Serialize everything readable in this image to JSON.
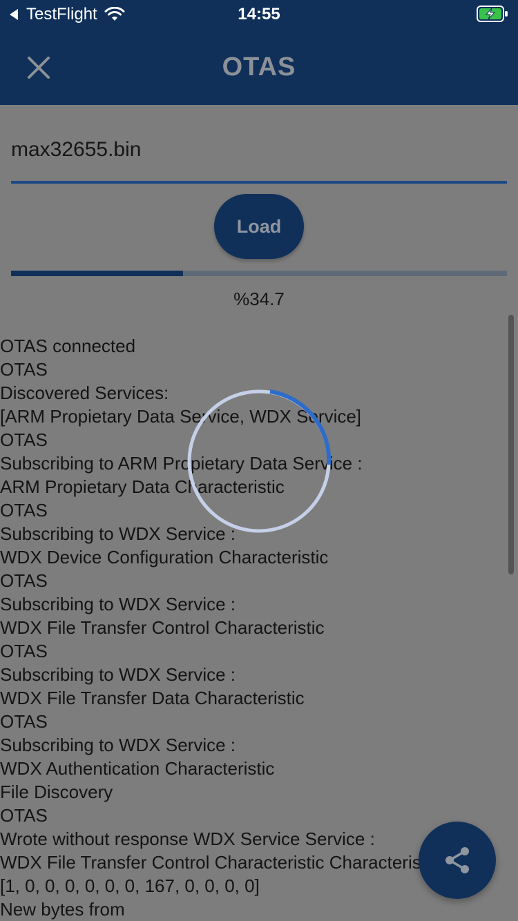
{
  "status_bar": {
    "carrier": "TestFlight",
    "time": "14:55",
    "icons": [
      "back-arrow-icon",
      "wifi-icon",
      "battery-charging-icon"
    ]
  },
  "app_bar": {
    "title": "OTAS",
    "close_icon": "close-icon"
  },
  "file_input": {
    "value": "max32655.bin"
  },
  "load_button": {
    "label": "Load"
  },
  "progress": {
    "percent_value": 34.7,
    "text": "%34.7"
  },
  "log": {
    "lines": [
      "OTAS connected",
      "OTAS",
      "Discovered Services:",
      "[ARM Propietary Data Service, WDX Service]",
      "OTAS",
      "Subscribing to ARM Propietary Data Service :",
      "ARM Propietary Data Characteristic",
      "OTAS",
      "Subscribing to WDX Service :",
      "WDX Device Configuration Characteristic",
      "OTAS",
      "Subscribing to WDX Service :",
      "WDX File Transfer Control Characteristic",
      "OTAS",
      "Subscribing to WDX Service :",
      "WDX File Transfer Data Characteristic",
      "OTAS",
      "Subscribing to WDX Service :",
      "WDX Authentication Characteristic",
      "File Discovery",
      "OTAS",
      "Wrote without response WDX Service Service :",
      "WDX File Transfer Control Characteristic Characteristic :",
      "[1, 0, 0, 0, 0, 0, 0, 167, 0, 0, 0, 0]",
      "New bytes from"
    ]
  },
  "fab": {
    "icon": "share-icon"
  },
  "colors": {
    "primary": "#10305a",
    "overlay_bg": "#7d7d7d",
    "spinner_track": "#c5d0e8",
    "spinner_arc": "#2f6cc8"
  }
}
